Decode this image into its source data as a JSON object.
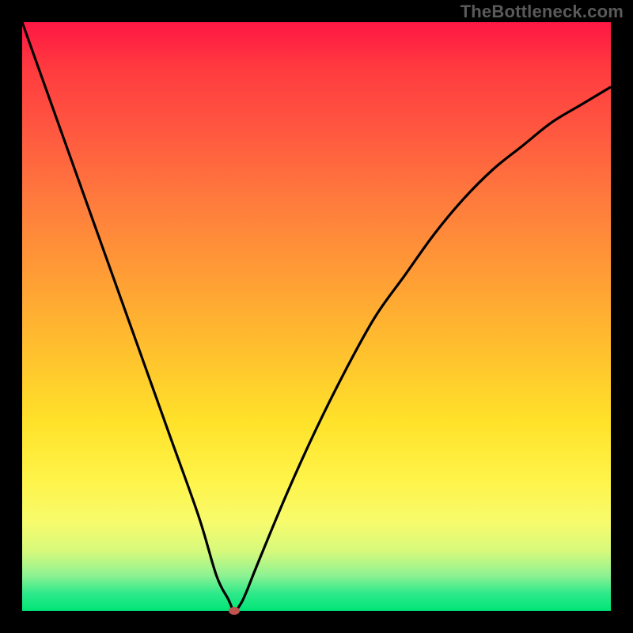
{
  "watermark": "TheBottleneck.com",
  "colors": {
    "frame_background": "#000000",
    "gradient_top": "#ff1744",
    "gradient_mid1": "#ff9a36",
    "gradient_mid2": "#ffe22a",
    "gradient_bottom": "#00e676",
    "curve_stroke": "#000000",
    "marker_fill": "#c0524f",
    "watermark_text": "#5a5a5a"
  },
  "chart_data": {
    "type": "line",
    "title": "",
    "xlabel": "",
    "ylabel": "",
    "xlim": [
      0,
      100
    ],
    "ylim": [
      0,
      100
    ],
    "grid": false,
    "legend": false,
    "series": [
      {
        "name": "bottleneck-curve",
        "x": [
          0,
          5,
          10,
          15,
          20,
          25,
          30,
          33,
          35,
          36,
          37,
          38,
          40,
          45,
          50,
          55,
          60,
          65,
          70,
          75,
          80,
          85,
          90,
          95,
          100
        ],
        "values": [
          100,
          86,
          72,
          58,
          44,
          30,
          16,
          6,
          2,
          0,
          1,
          3,
          8,
          20,
          31,
          41,
          50,
          57,
          64,
          70,
          75,
          79,
          83,
          86,
          89
        ]
      }
    ],
    "annotations": [
      {
        "type": "marker",
        "x": 36,
        "y": 0,
        "label": "optimal-point"
      }
    ],
    "background_gradient": {
      "orientation": "vertical",
      "stops": [
        {
          "pos": 0,
          "color": "#ff1744"
        },
        {
          "pos": 30,
          "color": "#ff7a3d"
        },
        {
          "pos": 55,
          "color": "#ffbe2e"
        },
        {
          "pos": 78,
          "color": "#fff44a"
        },
        {
          "pos": 94,
          "color": "#8df292"
        },
        {
          "pos": 100,
          "color": "#00e676"
        }
      ]
    }
  }
}
